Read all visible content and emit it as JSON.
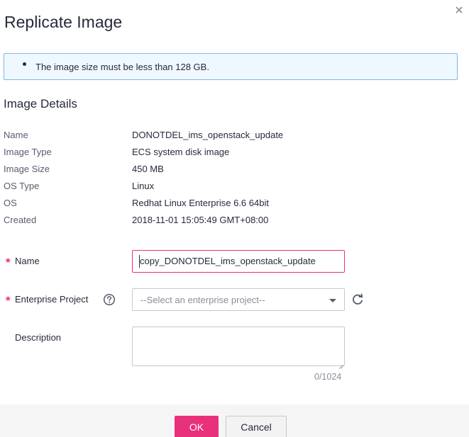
{
  "dialog": {
    "title": "Replicate Image",
    "notice": "The image size must be less than 128 GB."
  },
  "details": {
    "section_title": "Image Details",
    "rows": [
      {
        "label": "Name",
        "value": "DONOTDEL_ims_openstack_update"
      },
      {
        "label": "Image Type",
        "value": "ECS system disk image"
      },
      {
        "label": "Image Size",
        "value": "450 MB"
      },
      {
        "label": "OS Type",
        "value": "Linux"
      },
      {
        "label": "OS",
        "value": "Redhat Linux Enterprise 6.6 64bit"
      },
      {
        "label": "Created",
        "value": "2018-11-01 15:05:49 GMT+08:00"
      }
    ]
  },
  "form": {
    "required_mark": "*",
    "name_label": "Name",
    "name_value": "copy_DONOTDEL_ims_openstack_update",
    "enterprise_project_label": "Enterprise Project",
    "enterprise_project_placeholder": "--Select an enterprise project--",
    "description_label": "Description",
    "description_value": "",
    "description_counter": "0/1024"
  },
  "footer": {
    "ok_label": "OK",
    "cancel_label": "Cancel"
  },
  "colors": {
    "accent": "#e9307b",
    "notice_bg": "#f0f8ff",
    "notice_border": "#7fb8e0"
  },
  "icons": {
    "close": "close-icon",
    "help": "question-circle-icon",
    "refresh": "refresh-icon",
    "dropdown": "chevron-down-icon"
  }
}
